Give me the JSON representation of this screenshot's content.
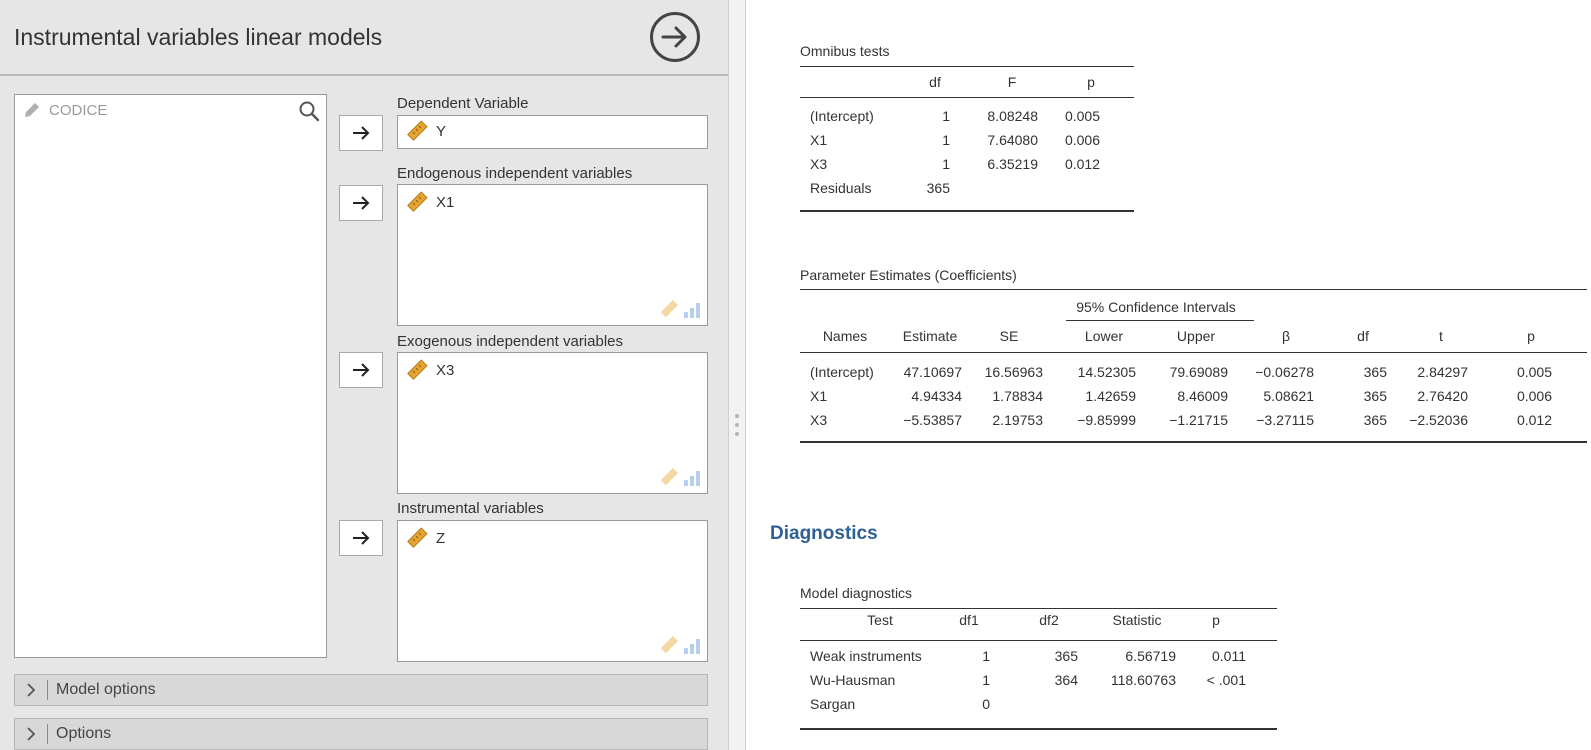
{
  "panel": {
    "title": "Instrumental variables linear models",
    "source_variables": [
      {
        "name": "CODICE",
        "icon": "pencil-icon"
      }
    ],
    "targets": {
      "dependent": {
        "label": "Dependent Variable",
        "items": [
          "Y"
        ]
      },
      "endogenous": {
        "label": "Endogenous independent variables",
        "items": [
          "X1"
        ]
      },
      "exogenous": {
        "label": "Exogenous independent variables",
        "items": [
          "X3"
        ]
      },
      "instrumental": {
        "label": "Instrumental variables",
        "items": [
          "Z"
        ]
      }
    },
    "sections": {
      "model_options": "Model options",
      "options": "Options"
    },
    "colors": {
      "panel_bg": "#e6e6e6",
      "ruler_orange": "#e6a532",
      "heading_blue": "#2f5f97"
    }
  },
  "results": {
    "omnibus": {
      "title": "Omnibus tests",
      "headers": [
        "",
        "df",
        "F",
        "p"
      ],
      "rows": [
        [
          "(Intercept)",
          "1",
          "8.08248",
          "0.005"
        ],
        [
          "X1",
          "1",
          "7.64080",
          "0.006"
        ],
        [
          "X3",
          "1",
          "6.35219",
          "0.012"
        ],
        [
          "Residuals",
          "365",
          "",
          ""
        ]
      ]
    },
    "coefficients": {
      "title": "Parameter Estimates (Coefficients)",
      "ci_header": "95% Confidence Intervals",
      "headers": [
        "Names",
        "Estimate",
        "SE",
        "Lower",
        "Upper",
        "β",
        "df",
        "t",
        "p"
      ],
      "rows": [
        [
          "(Intercept)",
          "47.10697",
          "16.56963",
          "14.52305",
          "79.69089",
          "−0.06278",
          "365",
          "2.84297",
          "0.005"
        ],
        [
          "X1",
          "4.94334",
          "1.78834",
          "1.42659",
          "8.46009",
          "5.08621",
          "365",
          "2.76420",
          "0.006"
        ],
        [
          "X3",
          "−5.53857",
          "2.19753",
          "−9.85999",
          "−1.21715",
          "−3.27115",
          "365",
          "−2.52036",
          "0.012"
        ]
      ]
    },
    "diagnostics_heading": "Diagnostics",
    "diagnostics": {
      "title": "Model diagnostics",
      "headers": [
        "Test",
        "df1",
        "df2",
        "Statistic",
        "p"
      ],
      "rows": [
        [
          "Weak instruments",
          "1",
          "365",
          "6.56719",
          "0.011"
        ],
        [
          "Wu-Hausman",
          "1",
          "364",
          "118.60763",
          "< .001"
        ],
        [
          "Sargan",
          "0",
          "",
          "",
          ""
        ]
      ]
    }
  }
}
